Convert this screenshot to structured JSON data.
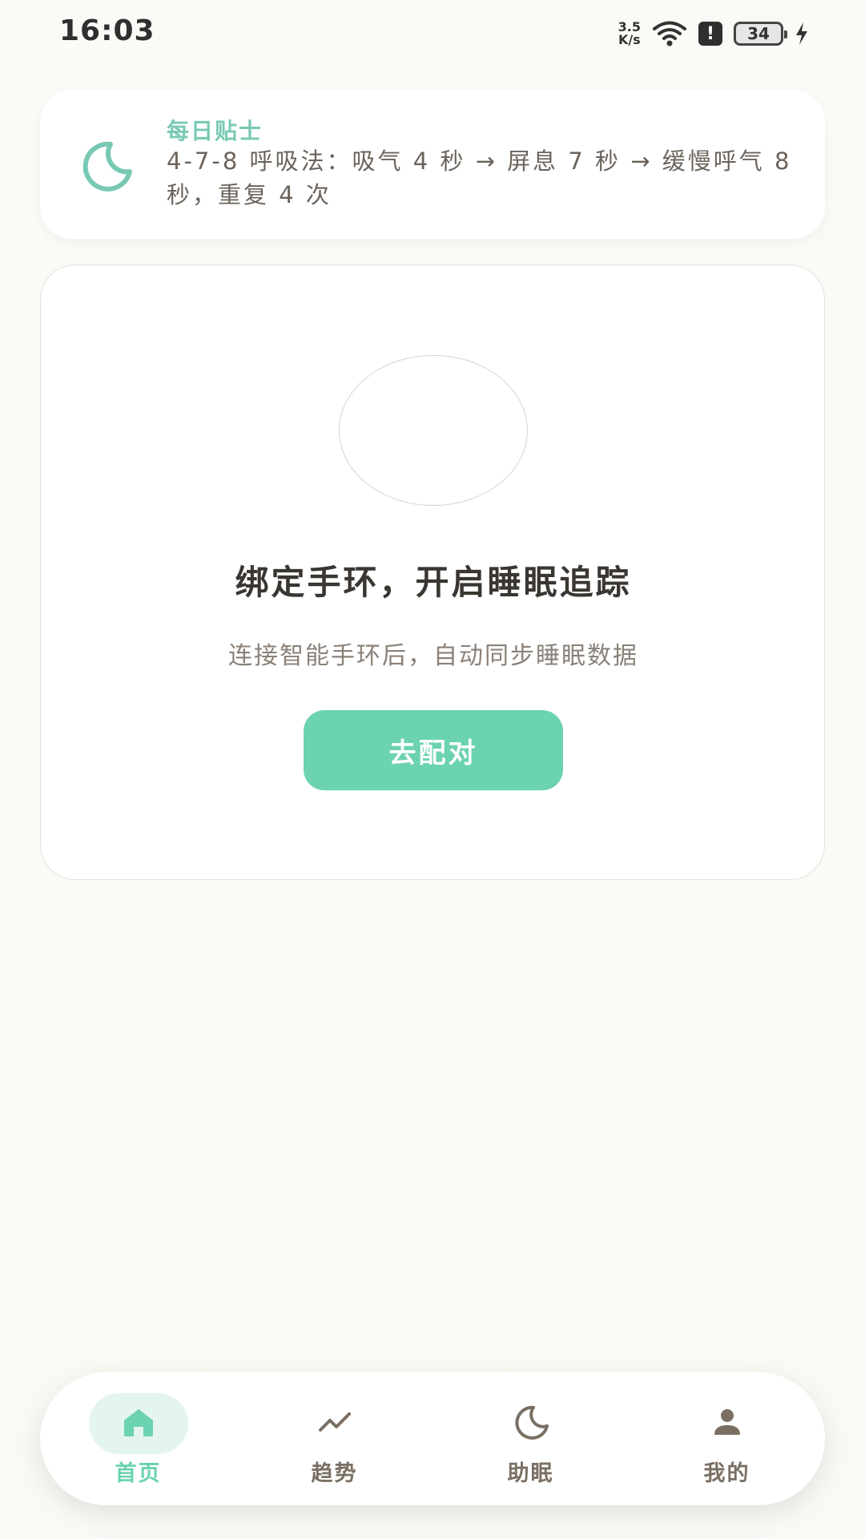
{
  "status_bar": {
    "time": "16:03",
    "net_speed_value": "3.5",
    "net_speed_unit": "K/s",
    "alert_glyph": "!",
    "battery": "34",
    "icons": [
      "wifi-icon",
      "alert-icon",
      "battery-icon",
      "charging-icon"
    ]
  },
  "tip": {
    "title": "每日贴士",
    "text": "4-7-8 呼吸法：吸气 4 秒 → 屏息 7 秒 → 缓慢呼气 8 秒，重复 4 次",
    "icon": "moon-icon"
  },
  "bind_card": {
    "title": "绑定手环，开启睡眠追踪",
    "subtitle": "连接智能手环后，自动同步睡眠数据",
    "button_label": "去配对"
  },
  "bottom_nav": {
    "items": [
      {
        "label": "首页",
        "icon": "home-icon",
        "active": true
      },
      {
        "label": "趋势",
        "icon": "trend-icon",
        "active": false
      },
      {
        "label": "助眠",
        "icon": "moon-icon",
        "active": false
      },
      {
        "label": "我的",
        "icon": "user-icon",
        "active": false
      }
    ]
  },
  "colors": {
    "accent": "#6bd2b2",
    "accent_light": "#e3f5ee",
    "nav_inactive": "#7a6f63",
    "background": "#fbf8f3"
  }
}
